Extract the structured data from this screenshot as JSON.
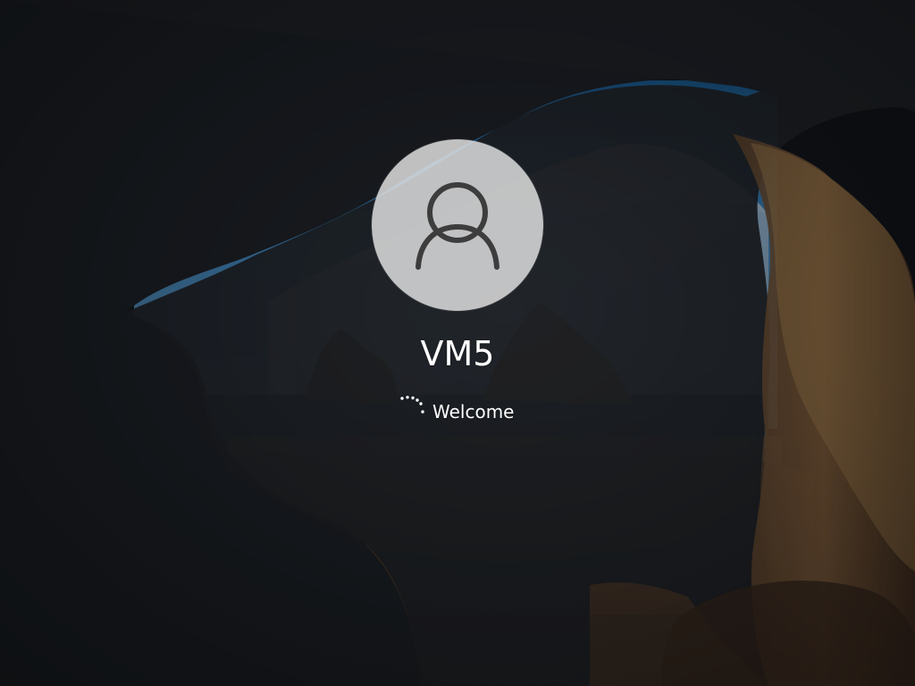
{
  "login": {
    "user_name": "VM5",
    "status_text": "Welcome"
  },
  "icons": {
    "avatar_icon": "user-icon",
    "loading_indicator": "spinner-icon"
  },
  "colors": {
    "avatar_background": "#e5e5e5",
    "text": "#ffffff"
  }
}
